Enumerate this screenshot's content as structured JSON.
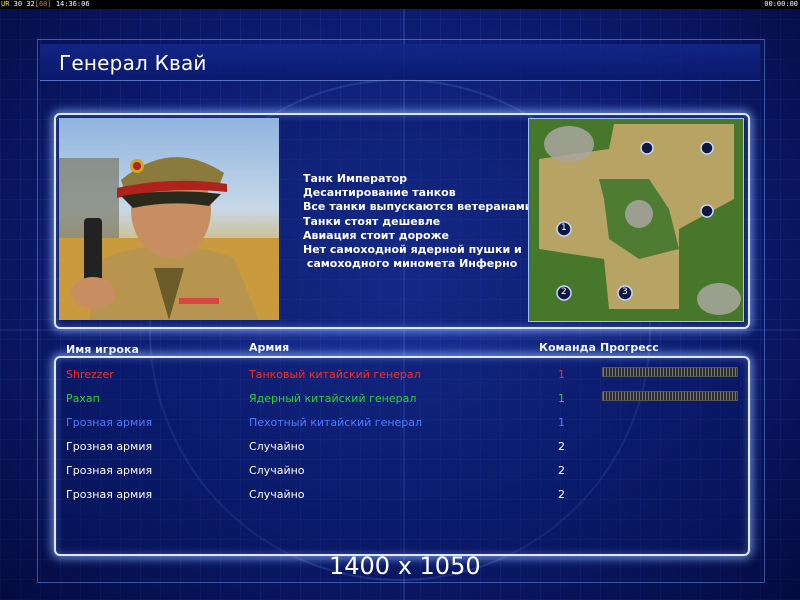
{
  "topbar": {
    "ur_label": "UR",
    "num_a": "30",
    "num_b": "32",
    "num_bracket": "[60]",
    "clock": "14:36:06",
    "timer": "00:00:00"
  },
  "title": "Генерал Квай",
  "traits": [
    "Танк Император",
    "Десантирование танков",
    "Все танки выпускаются ветеранами",
    "Танки стоят дешевле",
    "Авиация стоит дороже",
    "Нет самоходной ядерной пушки и",
    " самоходного миномета Инферно"
  ],
  "minimap": {
    "spawn_labels": [
      "1",
      "2",
      "3"
    ]
  },
  "headers": {
    "player": "Имя игрока",
    "army": "Армия",
    "team": "Команда",
    "progress": "Прогресс"
  },
  "players": [
    {
      "name": "Shrezzer",
      "army": "Танковый китайский генерал",
      "team": "1",
      "color": "#ff2a1a",
      "team_color": "#ff2a1a",
      "progress": 1.0,
      "show_progress": true
    },
    {
      "name": "Рахап",
      "army": "Ядерный китайский генерал",
      "team": "1",
      "color": "#2fd12f",
      "team_color": "#2fd12f",
      "progress": 1.0,
      "show_progress": true
    },
    {
      "name": "Грозная армия",
      "army": "Пехотный китайский генерал",
      "team": "1",
      "color": "#4c7cff",
      "team_color": "#4c7cff",
      "progress": null,
      "show_progress": false
    },
    {
      "name": "Грозная армия",
      "army": "Случайно",
      "team": "2",
      "color": "#ffffff",
      "team_color": "#ffffff",
      "progress": null,
      "show_progress": false
    },
    {
      "name": "Грозная армия",
      "army": "Случайно",
      "team": "2",
      "color": "#ffffff",
      "team_color": "#ffffff",
      "progress": null,
      "show_progress": false
    },
    {
      "name": "Грозная армия",
      "army": "Случайно",
      "team": "2",
      "color": "#ffffff",
      "team_color": "#ffffff",
      "progress": null,
      "show_progress": false
    }
  ],
  "resolution": "1400 x 1050"
}
